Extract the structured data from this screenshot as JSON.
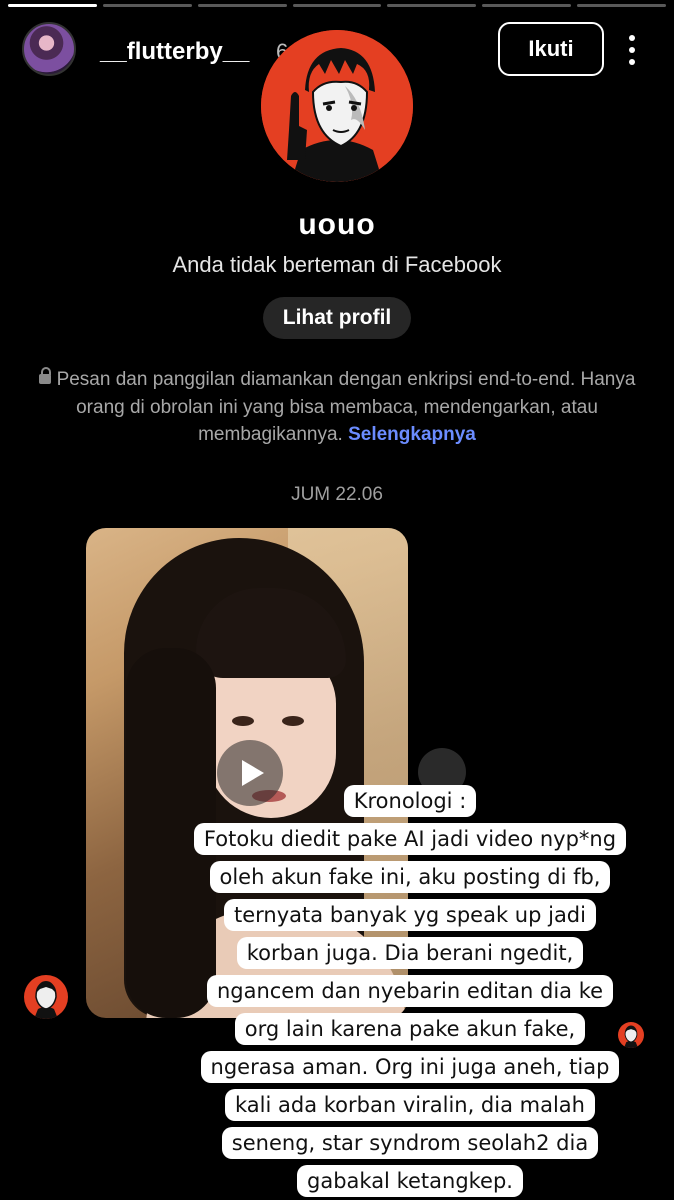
{
  "story": {
    "progress_segments": 7,
    "active_segments": [
      0
    ]
  },
  "header": {
    "username": "__flutterby__",
    "time": "6 jam",
    "follow_label": "Ikuti",
    "avatar_icon": "profile-photo",
    "more_icon": "more-vertical-icon"
  },
  "chat_profile": {
    "name": "uouo",
    "relation": "Anda tidak berteman di Facebook",
    "view_profile_label": "Lihat profil",
    "encryption_text": "Pesan dan panggilan diamankan dengan enkripsi end-to-end. Hanya orang di obrolan ini yang bisa membaca, mendengarkan, atau membagikannya.",
    "learn_more": "Selengkapnya",
    "accent_color": "#6b8cff",
    "profile_bg_color": "#e43f22"
  },
  "conversation": {
    "date": "JUM 22.06"
  },
  "caption": {
    "lines": [
      "Kronologi :",
      "Fotoku diedit pake AI jadi video nyp*ng",
      "oleh akun fake ini, aku posting di fb,",
      "ternyata banyak yg speak up jadi",
      "korban juga. Dia berani ngedit,",
      "ngancem dan nyebarin editan dia ke",
      "org lain karena pake akun fake,",
      "ngerasa aman. Org ini juga aneh, tiap",
      "kali ada korban viralin, dia malah",
      "seneng, star syndrom seolah2 dia",
      "gabakal ketangkep."
    ]
  }
}
